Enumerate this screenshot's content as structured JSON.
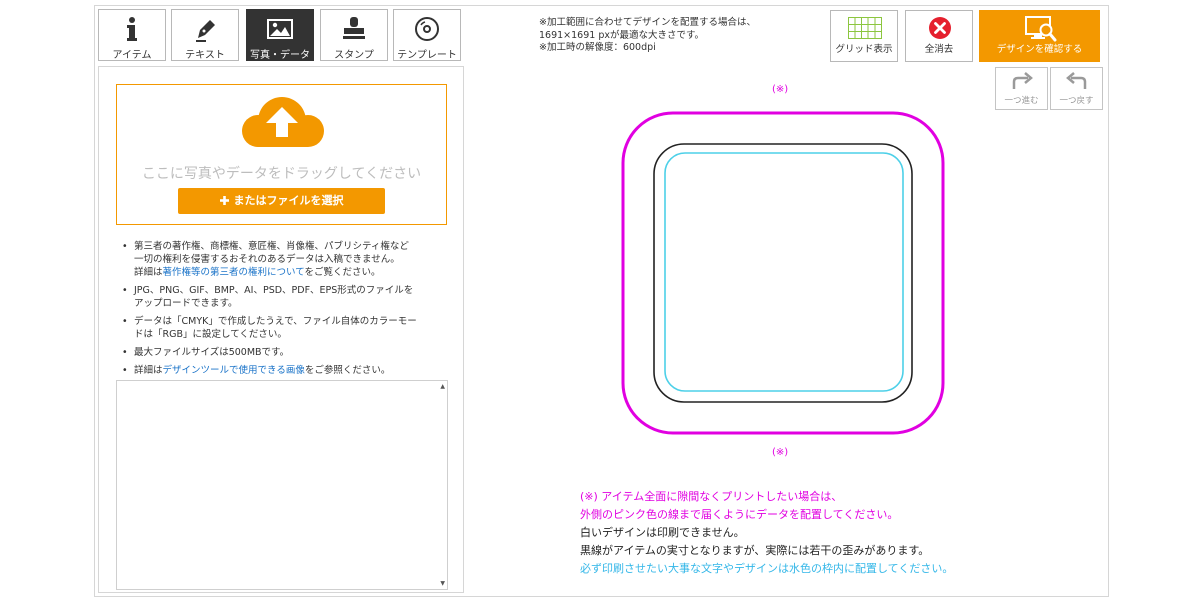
{
  "tabs": [
    {
      "label": "アイテム",
      "icon": "info-icon"
    },
    {
      "label": "テキスト",
      "icon": "pen-icon"
    },
    {
      "label": "写真・データ",
      "icon": "image-icon",
      "active": true
    },
    {
      "label": "スタンプ",
      "icon": "stamp-icon"
    },
    {
      "label": "テンプレート",
      "icon": "disc-icon"
    }
  ],
  "upload": {
    "drop_text": "ここに写真やデータをドラッグしてください",
    "button_label": "またはファイルを選択"
  },
  "notes": {
    "n1_line1": "第三者の著作権、商標権、意匠権、肖像権、パブリシティ権など",
    "n1_line2": "一切の権利を侵害するおそれのあるデータは入稿できません。",
    "n1_pre": "詳細は",
    "n1_link": "著作権等の第三者の権利について",
    "n1_post": "をご覧ください。",
    "n2_line1": "JPG、PNG、GIF、BMP、AI、PSD、PDF、EPS形式のファイルを",
    "n2_line2": "アップロードできます。",
    "n3_line1": "データは「CMYK」で作成したうえで、ファイル自体のカラーモー",
    "n3_line2": "ドは「RGB」に設定してください。",
    "n4": "最大ファイルサイズは500MBです。",
    "n5_pre": "詳細は",
    "n5_link": "デザインツールで使用できる画像",
    "n5_post": "をご参照ください。"
  },
  "info": {
    "line1": "※加工範囲に合わせてデザインを配置する場合は、",
    "line2": "1691×1691 pxが最適な大きさです。",
    "line3": "※加工時の解像度：600dpi"
  },
  "toolbar": {
    "grid_label": "グリッド表示",
    "clear_label": "全消去",
    "confirm_label": "デザインを確認する",
    "redo_label": "一つ進む",
    "undo_label": "一つ戻す"
  },
  "canvas": {
    "mark_top": "(※)",
    "mark_bottom": "(※)"
  },
  "caption": {
    "line1": "(※) アイテム全面に隙間なくプリントしたい場合は、",
    "line2": "外側のピンク色の線まで届くようにデータを配置してください。",
    "line3": "白いデザインは印刷できません。",
    "line4": "黒線がアイテムの実寸となりますが、実際には若干の歪みがあります。",
    "line5": "必ず印刷させたい大事な文字やデザインは水色の枠内に配置してください。"
  },
  "colors": {
    "accent": "#f39800",
    "pink": "#e100e1",
    "cyan": "#34b7e8",
    "link": "#1a73c8",
    "clear_red": "#e5202e",
    "grid_green": "#8cc63f"
  }
}
